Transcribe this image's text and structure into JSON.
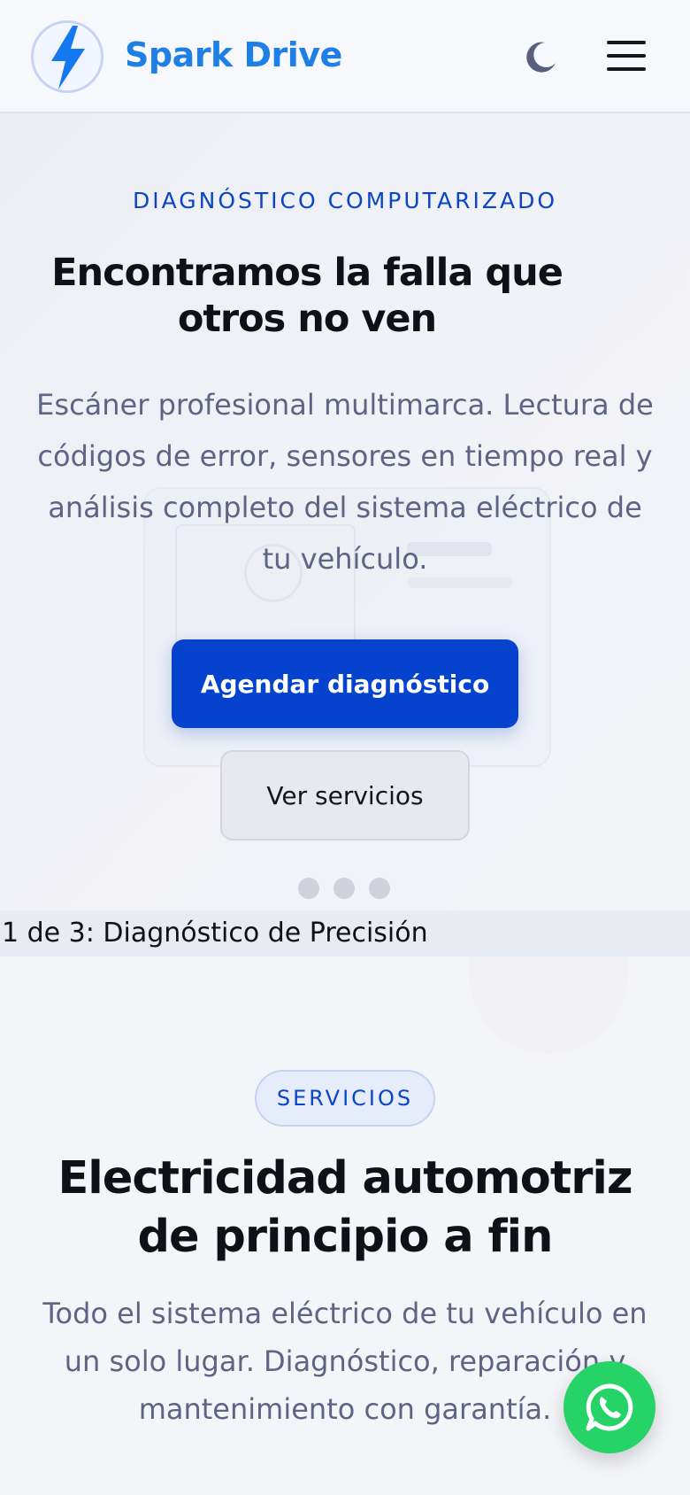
{
  "header": {
    "brand": "Spark Drive",
    "logo_icon": "lightning-bolt-icon",
    "theme_icon": "moon-icon",
    "menu_icon": "hamburger-menu-icon"
  },
  "hero": {
    "eyebrow": "DIAGNÓSTICO COMPUTARIZADO",
    "title": "Encontramos la falla que otros no ven",
    "description": "Escáner profesional multimarca. Lectura de códigos de error, sensores en tiempo real y análisis completo del sistema eléctrico de tu vehículo.",
    "primary_button": "Agendar diagnóstico",
    "secondary_button": "Ver servicios",
    "slide_count": 3,
    "active_slide": 1,
    "slide_status": "1 de 3: Diagnóstico de Precisión"
  },
  "services": {
    "badge": "SERVICIOS",
    "title": "Electricidad automotriz de principio a fin",
    "description": "Todo el sistema eléctrico de tu vehículo en un solo lugar. Diagnóstico, reparación y mantenimiento con garantía."
  },
  "floating": {
    "whatsapp_icon": "whatsapp-icon"
  },
  "colors": {
    "brand": "#1e7fe6",
    "accent": "#0543cf",
    "whatsapp": "#25d366"
  }
}
